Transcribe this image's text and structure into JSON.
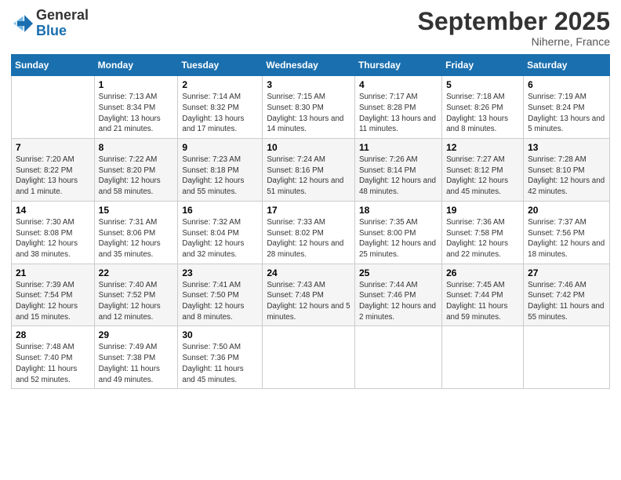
{
  "logo": {
    "line1": "General",
    "line2": "Blue"
  },
  "title": "September 2025",
  "subtitle": "Niherne, France",
  "days_header": [
    "Sunday",
    "Monday",
    "Tuesday",
    "Wednesday",
    "Thursday",
    "Friday",
    "Saturday"
  ],
  "weeks": [
    [
      {
        "day": "",
        "sunrise": "",
        "sunset": "",
        "daylight": ""
      },
      {
        "day": "1",
        "sunrise": "Sunrise: 7:13 AM",
        "sunset": "Sunset: 8:34 PM",
        "daylight": "Daylight: 13 hours and 21 minutes."
      },
      {
        "day": "2",
        "sunrise": "Sunrise: 7:14 AM",
        "sunset": "Sunset: 8:32 PM",
        "daylight": "Daylight: 13 hours and 17 minutes."
      },
      {
        "day": "3",
        "sunrise": "Sunrise: 7:15 AM",
        "sunset": "Sunset: 8:30 PM",
        "daylight": "Daylight: 13 hours and 14 minutes."
      },
      {
        "day": "4",
        "sunrise": "Sunrise: 7:17 AM",
        "sunset": "Sunset: 8:28 PM",
        "daylight": "Daylight: 13 hours and 11 minutes."
      },
      {
        "day": "5",
        "sunrise": "Sunrise: 7:18 AM",
        "sunset": "Sunset: 8:26 PM",
        "daylight": "Daylight: 13 hours and 8 minutes."
      },
      {
        "day": "6",
        "sunrise": "Sunrise: 7:19 AM",
        "sunset": "Sunset: 8:24 PM",
        "daylight": "Daylight: 13 hours and 5 minutes."
      }
    ],
    [
      {
        "day": "7",
        "sunrise": "Sunrise: 7:20 AM",
        "sunset": "Sunset: 8:22 PM",
        "daylight": "Daylight: 13 hours and 1 minute."
      },
      {
        "day": "8",
        "sunrise": "Sunrise: 7:22 AM",
        "sunset": "Sunset: 8:20 PM",
        "daylight": "Daylight: 12 hours and 58 minutes."
      },
      {
        "day": "9",
        "sunrise": "Sunrise: 7:23 AM",
        "sunset": "Sunset: 8:18 PM",
        "daylight": "Daylight: 12 hours and 55 minutes."
      },
      {
        "day": "10",
        "sunrise": "Sunrise: 7:24 AM",
        "sunset": "Sunset: 8:16 PM",
        "daylight": "Daylight: 12 hours and 51 minutes."
      },
      {
        "day": "11",
        "sunrise": "Sunrise: 7:26 AM",
        "sunset": "Sunset: 8:14 PM",
        "daylight": "Daylight: 12 hours and 48 minutes."
      },
      {
        "day": "12",
        "sunrise": "Sunrise: 7:27 AM",
        "sunset": "Sunset: 8:12 PM",
        "daylight": "Daylight: 12 hours and 45 minutes."
      },
      {
        "day": "13",
        "sunrise": "Sunrise: 7:28 AM",
        "sunset": "Sunset: 8:10 PM",
        "daylight": "Daylight: 12 hours and 42 minutes."
      }
    ],
    [
      {
        "day": "14",
        "sunrise": "Sunrise: 7:30 AM",
        "sunset": "Sunset: 8:08 PM",
        "daylight": "Daylight: 12 hours and 38 minutes."
      },
      {
        "day": "15",
        "sunrise": "Sunrise: 7:31 AM",
        "sunset": "Sunset: 8:06 PM",
        "daylight": "Daylight: 12 hours and 35 minutes."
      },
      {
        "day": "16",
        "sunrise": "Sunrise: 7:32 AM",
        "sunset": "Sunset: 8:04 PM",
        "daylight": "Daylight: 12 hours and 32 minutes."
      },
      {
        "day": "17",
        "sunrise": "Sunrise: 7:33 AM",
        "sunset": "Sunset: 8:02 PM",
        "daylight": "Daylight: 12 hours and 28 minutes."
      },
      {
        "day": "18",
        "sunrise": "Sunrise: 7:35 AM",
        "sunset": "Sunset: 8:00 PM",
        "daylight": "Daylight: 12 hours and 25 minutes."
      },
      {
        "day": "19",
        "sunrise": "Sunrise: 7:36 AM",
        "sunset": "Sunset: 7:58 PM",
        "daylight": "Daylight: 12 hours and 22 minutes."
      },
      {
        "day": "20",
        "sunrise": "Sunrise: 7:37 AM",
        "sunset": "Sunset: 7:56 PM",
        "daylight": "Daylight: 12 hours and 18 minutes."
      }
    ],
    [
      {
        "day": "21",
        "sunrise": "Sunrise: 7:39 AM",
        "sunset": "Sunset: 7:54 PM",
        "daylight": "Daylight: 12 hours and 15 minutes."
      },
      {
        "day": "22",
        "sunrise": "Sunrise: 7:40 AM",
        "sunset": "Sunset: 7:52 PM",
        "daylight": "Daylight: 12 hours and 12 minutes."
      },
      {
        "day": "23",
        "sunrise": "Sunrise: 7:41 AM",
        "sunset": "Sunset: 7:50 PM",
        "daylight": "Daylight: 12 hours and 8 minutes."
      },
      {
        "day": "24",
        "sunrise": "Sunrise: 7:43 AM",
        "sunset": "Sunset: 7:48 PM",
        "daylight": "Daylight: 12 hours and 5 minutes."
      },
      {
        "day": "25",
        "sunrise": "Sunrise: 7:44 AM",
        "sunset": "Sunset: 7:46 PM",
        "daylight": "Daylight: 12 hours and 2 minutes."
      },
      {
        "day": "26",
        "sunrise": "Sunrise: 7:45 AM",
        "sunset": "Sunset: 7:44 PM",
        "daylight": "Daylight: 11 hours and 59 minutes."
      },
      {
        "day": "27",
        "sunrise": "Sunrise: 7:46 AM",
        "sunset": "Sunset: 7:42 PM",
        "daylight": "Daylight: 11 hours and 55 minutes."
      }
    ],
    [
      {
        "day": "28",
        "sunrise": "Sunrise: 7:48 AM",
        "sunset": "Sunset: 7:40 PM",
        "daylight": "Daylight: 11 hours and 52 minutes."
      },
      {
        "day": "29",
        "sunrise": "Sunrise: 7:49 AM",
        "sunset": "Sunset: 7:38 PM",
        "daylight": "Daylight: 11 hours and 49 minutes."
      },
      {
        "day": "30",
        "sunrise": "Sunrise: 7:50 AM",
        "sunset": "Sunset: 7:36 PM",
        "daylight": "Daylight: 11 hours and 45 minutes."
      },
      {
        "day": "",
        "sunrise": "",
        "sunset": "",
        "daylight": ""
      },
      {
        "day": "",
        "sunrise": "",
        "sunset": "",
        "daylight": ""
      },
      {
        "day": "",
        "sunrise": "",
        "sunset": "",
        "daylight": ""
      },
      {
        "day": "",
        "sunrise": "",
        "sunset": "",
        "daylight": ""
      }
    ]
  ]
}
